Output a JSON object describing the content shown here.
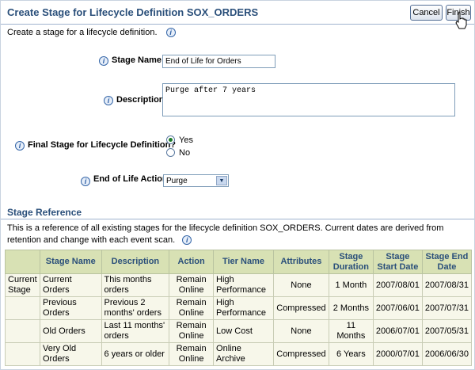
{
  "header": {
    "title": "Create Stage for Lifecycle Definition SOX_ORDERS",
    "cancel_label": "Cancel",
    "finish_label": "Finish"
  },
  "intro": "Create a stage for a lifecycle definition.",
  "form": {
    "stage_name_label": "Stage Name",
    "stage_name_value": "End of Life for Orders",
    "description_label": "Description",
    "description_value": "Purge after 7 years",
    "final_stage_label": "Final Stage for Lifecycle Definition?",
    "final_stage_yes": "Yes",
    "final_stage_no": "No",
    "final_stage_selected": "Yes",
    "eol_action_label": "End of Life Action",
    "eol_action_value": "Purge"
  },
  "stage_reference": {
    "heading": "Stage Reference",
    "text": "This is a reference of all existing stages for the lifecycle definition SOX_ORDERS. Current dates are derived from retention and change with each event scan.",
    "columns": [
      "",
      "Stage Name",
      "Description",
      "Action",
      "Tier Name",
      "Attributes",
      "Stage Duration",
      "Stage Start Date",
      "Stage End Date"
    ],
    "rows": [
      [
        "Current Stage",
        "Current Orders",
        "This months orders",
        "Remain Online",
        "High Performance",
        "None",
        "1 Month",
        "2007/08/01",
        "2007/08/31"
      ],
      [
        "",
        "Previous Orders",
        "Previous 2 months' orders",
        "Remain Online",
        "High Performance",
        "Compressed",
        "2 Months",
        "2007/06/01",
        "2007/07/31"
      ],
      [
        "",
        "Old Orders",
        "Last 11 months' orders",
        "Remain Online",
        "Low Cost",
        "None",
        "11 Months",
        "2006/07/01",
        "2007/05/31"
      ],
      [
        "",
        "Very Old Orders",
        "6 years or older",
        "Remain Online",
        "Online Archive",
        "Compressed",
        "6 Years",
        "2000/07/01",
        "2006/06/30"
      ]
    ]
  }
}
